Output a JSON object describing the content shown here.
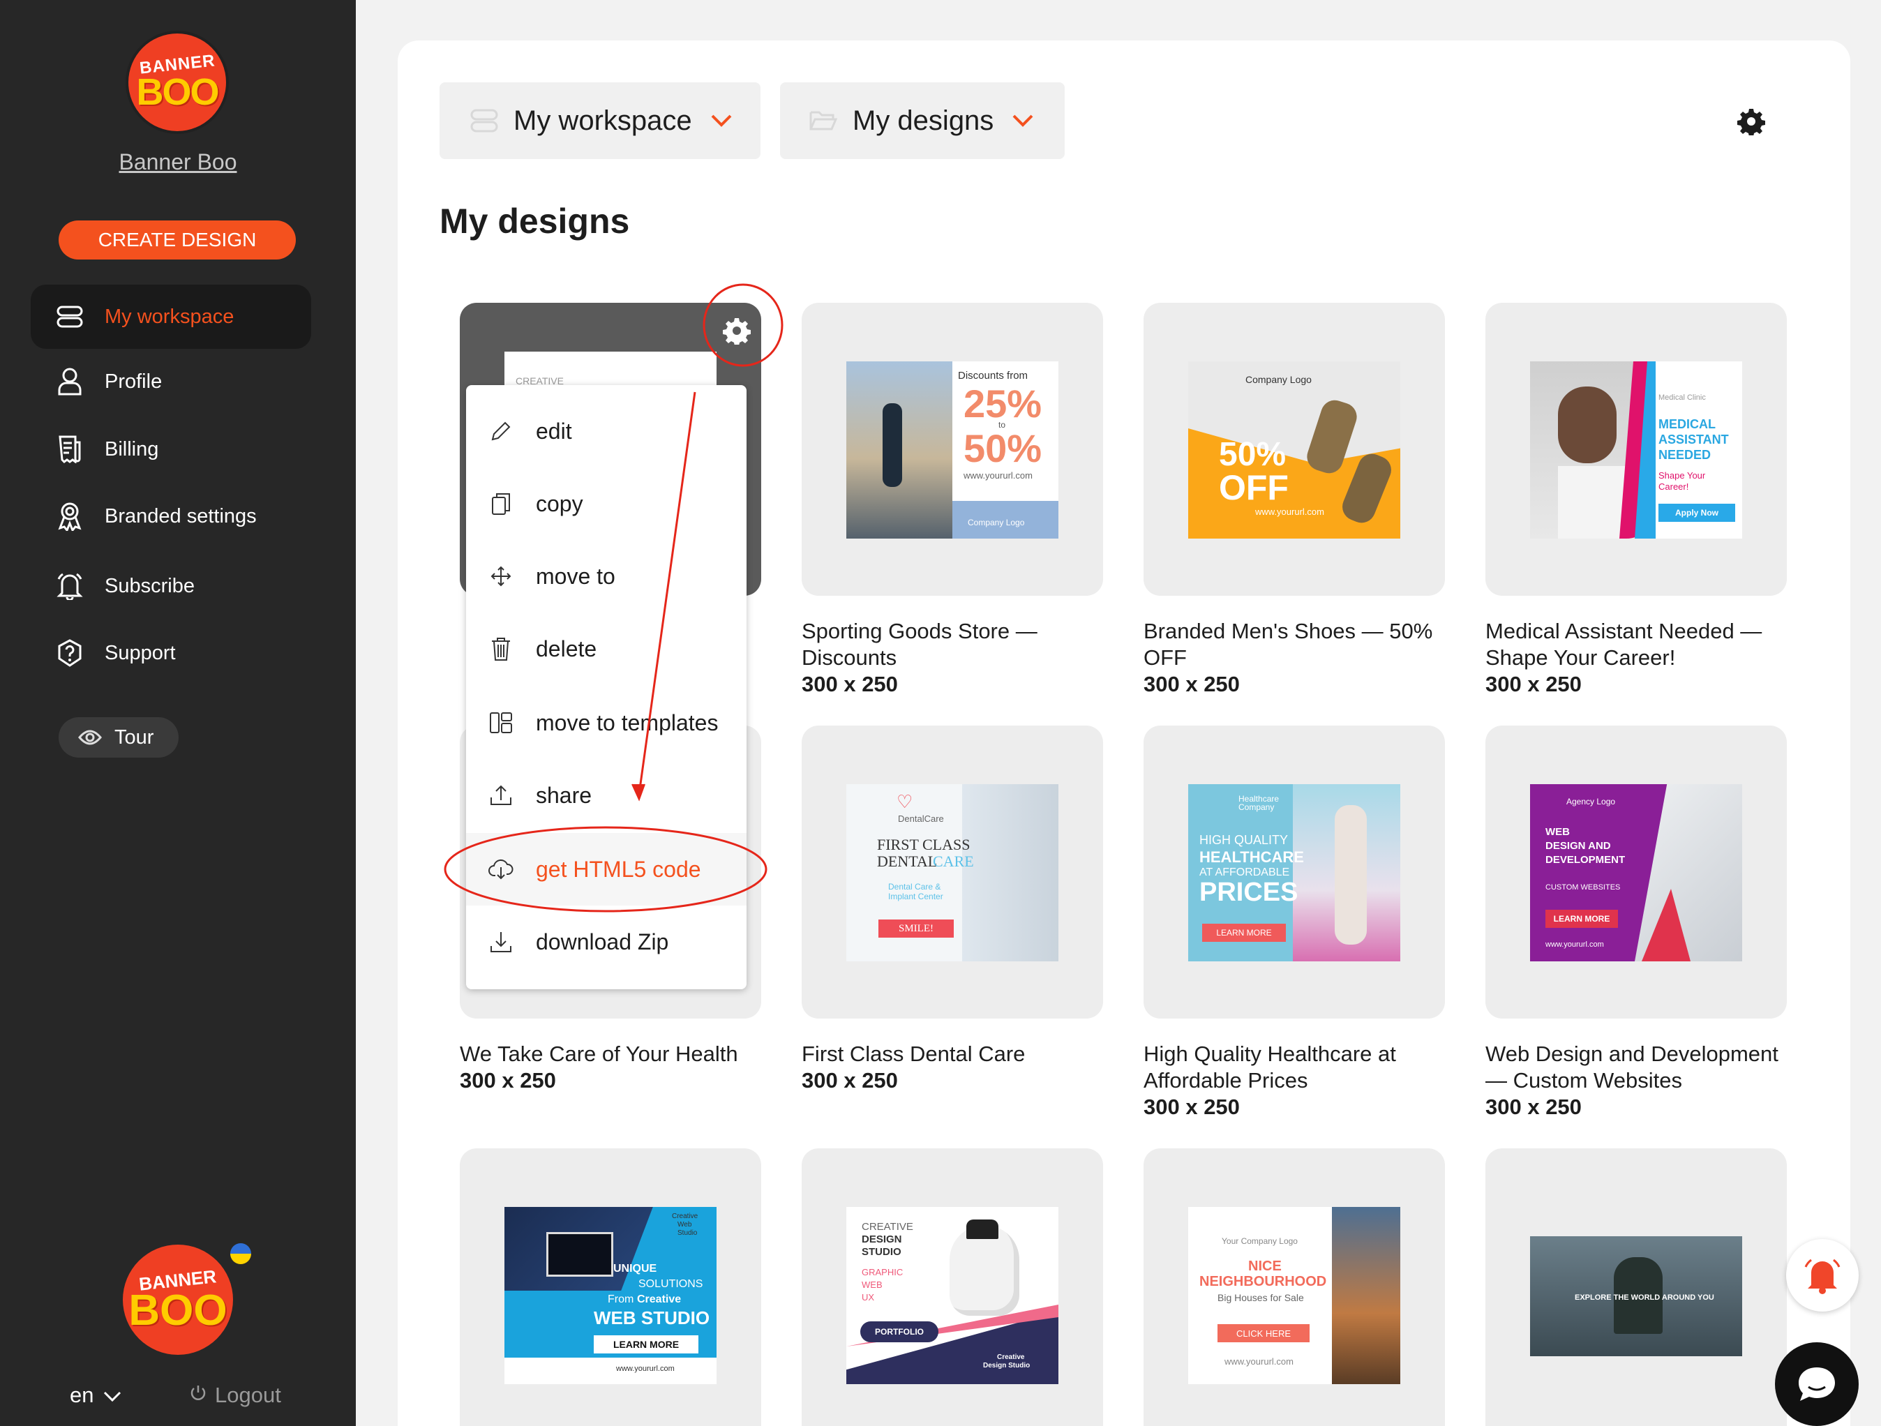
{
  "sidebar": {
    "brand_name": "Banner Boo",
    "logo_text_top": "BANNER",
    "logo_text_bottom": "BOO",
    "create_button": "CREATE DESIGN",
    "nav": [
      {
        "label": "My workspace",
        "icon": "workspace-icon",
        "active": true
      },
      {
        "label": "Profile",
        "icon": "user-icon"
      },
      {
        "label": "Billing",
        "icon": "billing-icon"
      },
      {
        "label": "Branded settings",
        "icon": "badge-icon"
      },
      {
        "label": "Subscribe",
        "icon": "bell-icon"
      },
      {
        "label": "Support",
        "icon": "help-icon"
      }
    ],
    "tour_label": "Tour",
    "language": "en",
    "logout_label": "Logout"
  },
  "header": {
    "workspace_dropdown": "My workspace",
    "designs_dropdown": "My designs"
  },
  "page_title": "My designs",
  "context_menu": {
    "items": [
      {
        "label": "edit",
        "icon": "pencil-icon"
      },
      {
        "label": "copy",
        "icon": "copy-icon"
      },
      {
        "label": "move to",
        "icon": "move-icon"
      },
      {
        "label": "delete",
        "icon": "trash-icon"
      },
      {
        "label": "move to templates",
        "icon": "templates-icon"
      },
      {
        "label": "share",
        "icon": "share-icon"
      },
      {
        "label": "get HTML5 code",
        "icon": "cloud-code-icon",
        "highlighted": true
      },
      {
        "label": "download Zip",
        "icon": "download-icon"
      }
    ]
  },
  "cards": [
    {
      "title": "",
      "size": "",
      "thumb_text": [
        "CREATIVE"
      ]
    },
    {
      "title": "Sporting Goods Store — Discounts",
      "size": "300 x 250",
      "thumb_text": [
        "Discounts from",
        "25%",
        "to",
        "50%",
        "www.yoururl.com",
        "Company Logo"
      ]
    },
    {
      "title": "Branded Men's Shoes — 50% OFF",
      "size": "300 x 250",
      "thumb_text": [
        "Company Logo",
        "50%",
        "OFF",
        "www.yoururl.com"
      ]
    },
    {
      "title": "Medical Assistant Needed — Shape Your Career!",
      "size": "300 x 250",
      "thumb_text": [
        "Medical Clinic",
        "MEDICAL",
        "ASSISTANT",
        "NEEDED",
        "Shape Your",
        "Career!",
        "Apply Now"
      ]
    },
    {
      "title": "We Take Care of Your Health",
      "size": "300 x 250",
      "thumb_text": []
    },
    {
      "title": "First Class Dental Care",
      "size": "300 x 250",
      "thumb_text": [
        "DentalCare",
        "FIRST CLASS",
        "DENTAL",
        "CARE",
        "Dental Care &",
        "Implant Center",
        "SMILE!"
      ]
    },
    {
      "title": "High Quality Healthcare at Affordable Prices",
      "size": "300 x 250",
      "thumb_text": [
        "Healthcare",
        "Company",
        "HIGH QUALITY",
        "HEALTHCARE",
        "AT AFFORDABLE",
        "PRICES",
        "LEARN MORE"
      ]
    },
    {
      "title": "Web Design and Development — Custom Websites",
      "size": "300 x 250",
      "thumb_text": [
        "Agency Logo",
        "WEB",
        "DESIGN AND",
        "DEVELOPMENT",
        "CUSTOM WEBSITES",
        "LEARN MORE",
        "www.yoururl.com"
      ]
    },
    {
      "title": "",
      "size": "",
      "thumb_text": [
        "Creative",
        "Web",
        "Studio",
        "UNIQUE",
        "SOLUTIONS",
        "From",
        "Creative",
        "WEB STUDIO",
        "LEARN MORE",
        "www.yoururl.com"
      ]
    },
    {
      "title": "",
      "size": "",
      "thumb_text": [
        "CREATIVE",
        "DESIGN",
        "STUDIO",
        "GRAPHIC",
        "WEB",
        "UX",
        "PORTFOLIO",
        "Creative",
        "Design Studio"
      ]
    },
    {
      "title": "",
      "size": "",
      "thumb_text": [
        "Your Company Logo",
        "NICE",
        "NEIGHBOURHOOD",
        "Big Houses for Sale",
        "CLICK HERE",
        "www.yoururl.com"
      ]
    },
    {
      "title": "",
      "size": "",
      "thumb_text": [
        "EXPLORE THE WORLD AROUND YOU"
      ]
    }
  ],
  "colors": {
    "accent": "#f4511e",
    "sidebar_bg": "#272727",
    "annotation_red": "#e5261a"
  }
}
